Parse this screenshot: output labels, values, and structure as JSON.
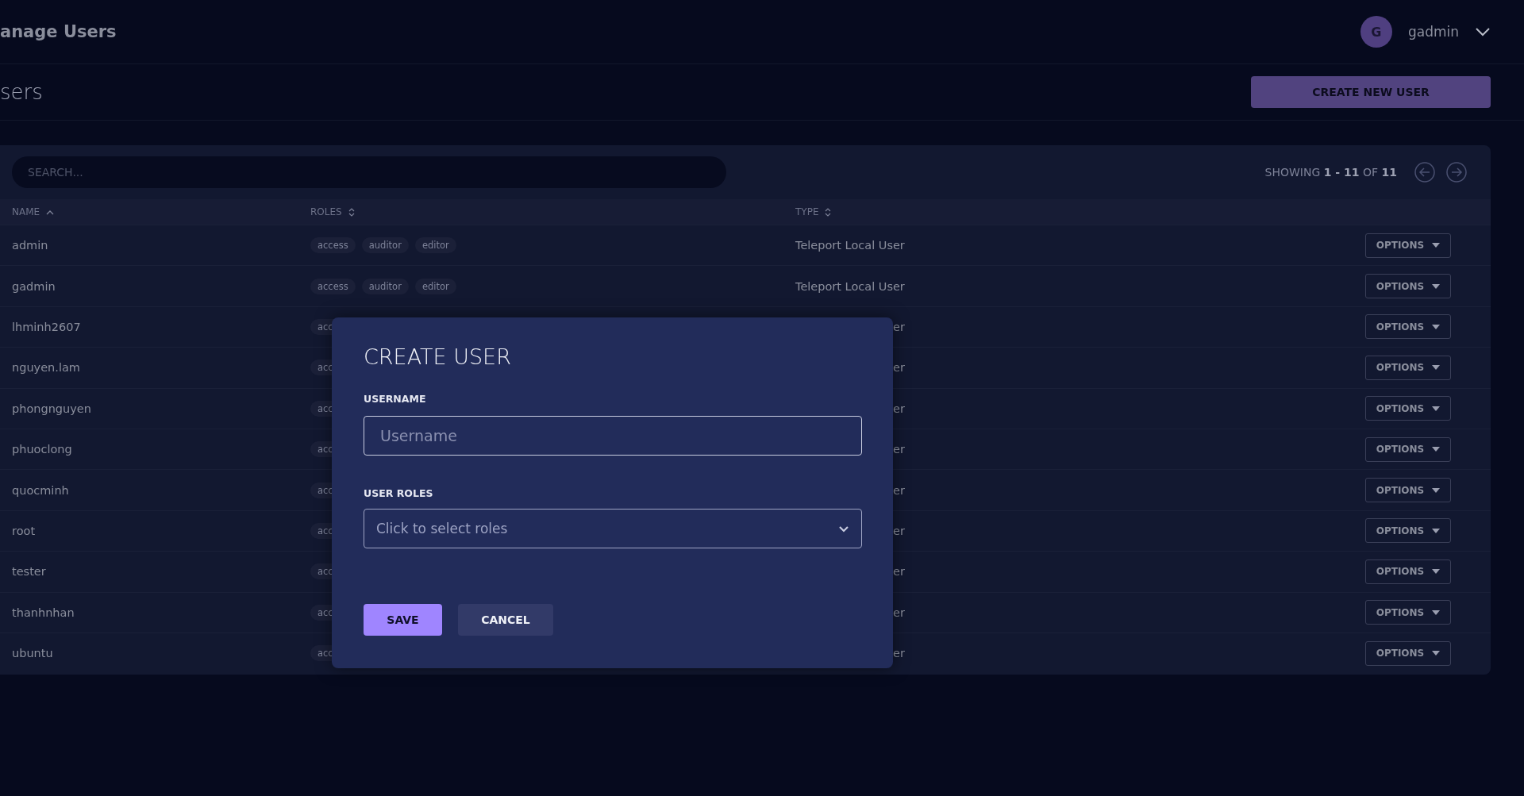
{
  "topbar": {
    "title": "anage Users",
    "user": {
      "initial": "G",
      "name": "gadmin"
    }
  },
  "header": {
    "title": "sers",
    "create_button": "CREATE NEW USER"
  },
  "search": {
    "placeholder": "SEARCH..."
  },
  "pagination": {
    "text": "SHOWING **1 - 11** OF **11**"
  },
  "table": {
    "columns": [
      {
        "label": "NAME",
        "sorted": true
      },
      {
        "label": "ROLES",
        "sorted": false
      },
      {
        "label": "TYPE",
        "sorted": false
      }
    ],
    "rows": [
      {
        "kind": "full",
        "name": "admin",
        "roles": [
          "access",
          "auditor",
          "editor"
        ],
        "type": "Teleport Local User",
        "options": "OPTIONS"
      },
      {
        "kind": "full",
        "name": "gadmin",
        "roles": [
          "access",
          "auditor",
          "editor"
        ],
        "type": "Teleport Local User",
        "options": "OPTIONS"
      },
      {
        "kind": "covered",
        "name": "lhminh2607",
        "roles": [
          "acc"
        ],
        "type": "er",
        "options": "OPTIONS"
      },
      {
        "kind": "covered",
        "name": "nguyen.lam",
        "roles": [
          "acc"
        ],
        "type": "er",
        "options": "OPTIONS"
      },
      {
        "kind": "covered",
        "name": "phongnguyen",
        "roles": [
          "acc"
        ],
        "type": "er",
        "options": "OPTIONS"
      },
      {
        "kind": "covered",
        "name": "phuoclong",
        "roles": [
          "acc"
        ],
        "type": "er",
        "options": "OPTIONS"
      },
      {
        "kind": "covered",
        "name": "quocminh",
        "roles": [
          "acc"
        ],
        "type": "er",
        "options": "OPTIONS"
      },
      {
        "kind": "covered",
        "name": "root",
        "roles": [
          "acc"
        ],
        "type": "er",
        "options": "OPTIONS"
      },
      {
        "kind": "covered",
        "name": "tester",
        "roles": [
          "acc"
        ],
        "type": "er",
        "options": "OPTIONS"
      },
      {
        "kind": "covered",
        "name": "thanhnhan",
        "roles": [
          "acc"
        ],
        "type": "er",
        "options": "OPTIONS"
      },
      {
        "kind": "covered",
        "name": "ubuntu",
        "roles": [
          "acc"
        ],
        "type": "er",
        "options": "OPTIONS"
      }
    ]
  },
  "dialog": {
    "title": "CREATE USER",
    "username": {
      "label": "USERNAME",
      "placeholder": "Username"
    },
    "roles": {
      "label": "USER ROLES",
      "placeholder": "Click to select roles"
    },
    "buttons": [
      {
        "label": "SAVE",
        "kind": "primary"
      },
      {
        "label": "CANCEL",
        "kind": "secondary"
      }
    ]
  }
}
